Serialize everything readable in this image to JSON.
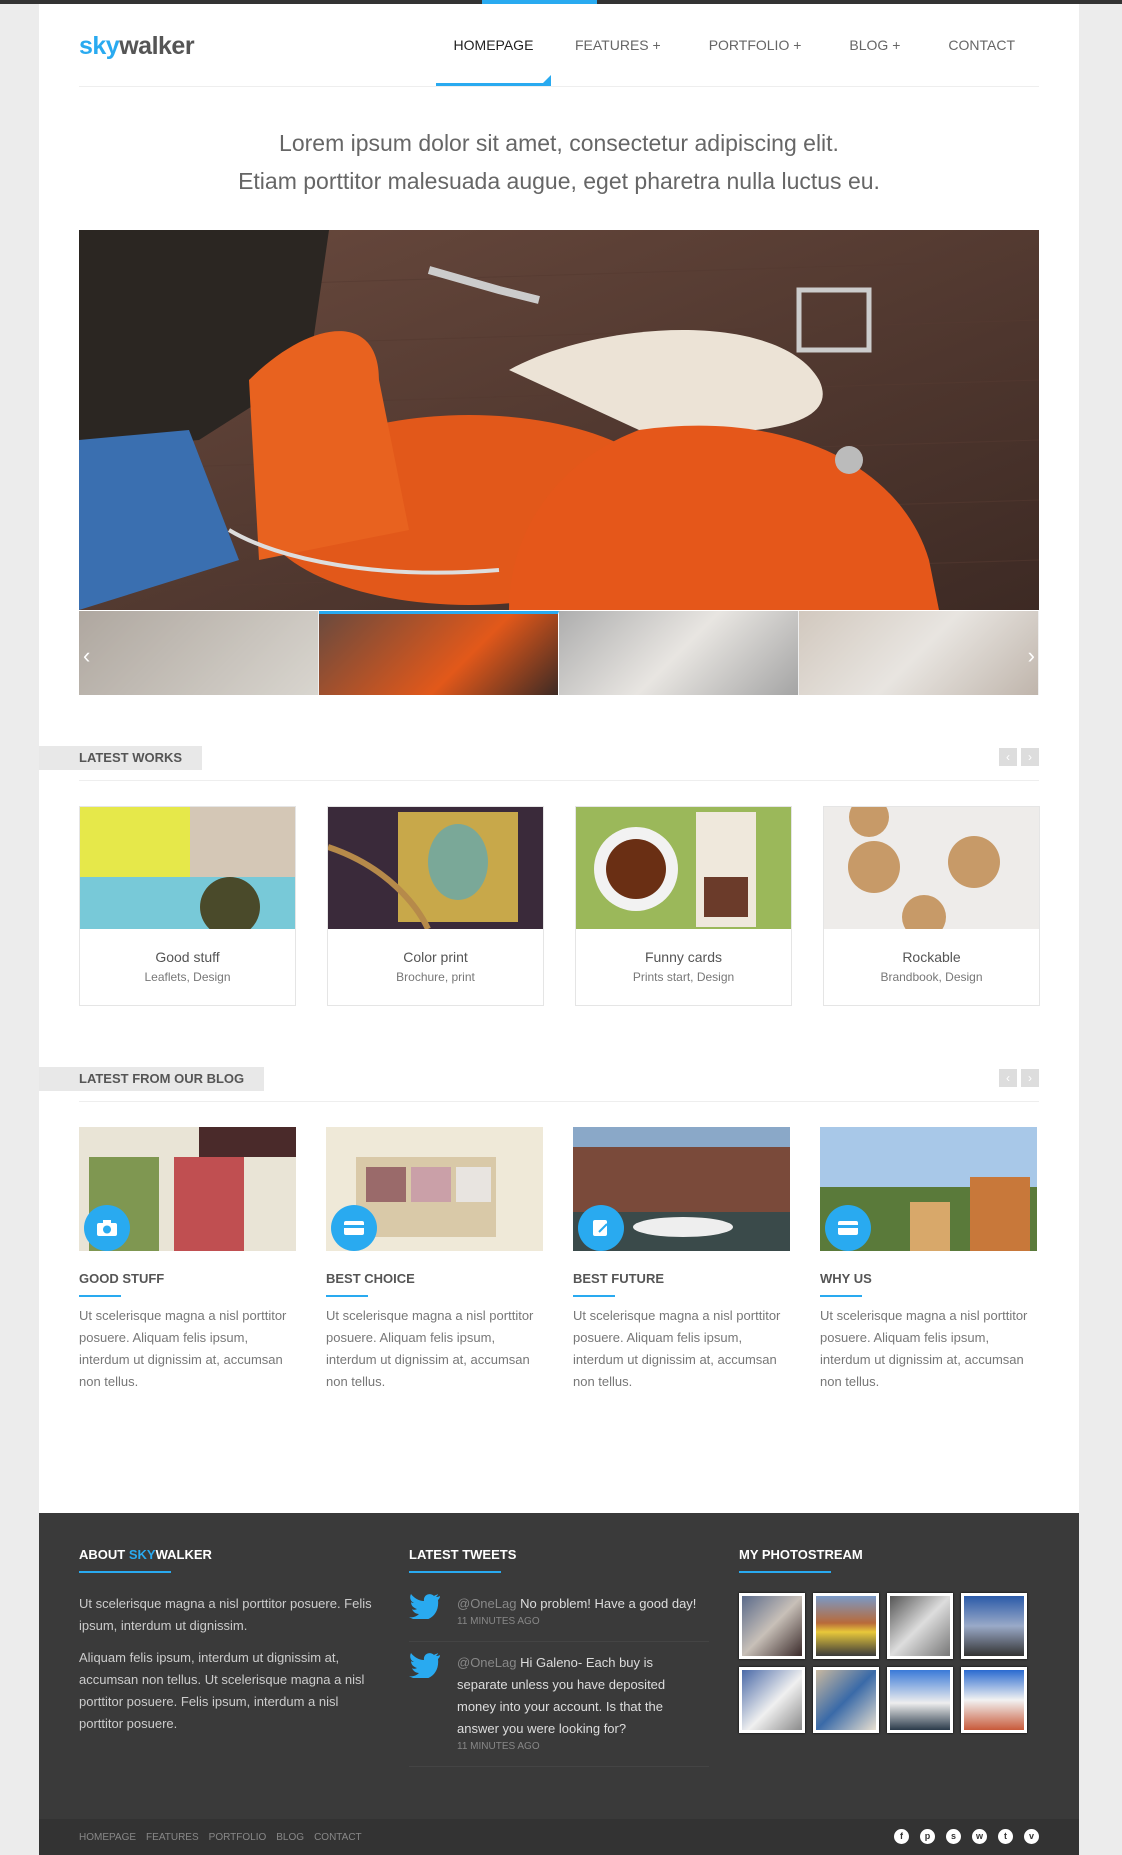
{
  "colors": {
    "accent": "#29aaf0",
    "footer_bg": "#3a3a3a",
    "bottom_bar": "#333333"
  },
  "logo": {
    "sky": "sky",
    "walker": "walker"
  },
  "nav": [
    {
      "label": "HOMEPAGE",
      "active": true
    },
    {
      "label": "FEATURES +"
    },
    {
      "label": "PORTFOLIO +"
    },
    {
      "label": "BLOG +"
    },
    {
      "label": "CONTACT"
    }
  ],
  "intro": {
    "line1": "Lorem ipsum dolor sit amet, consectetur adipiscing elit.",
    "line2": "Etiam porttitor malesuada augue, eget pharetra nulla luctus eu."
  },
  "latest_works": {
    "title": "LATEST WORKS",
    "items": [
      {
        "name": "Good stuff",
        "cats": "Leaflets, Design"
      },
      {
        "name": "Color print",
        "cats": "Brochure, print"
      },
      {
        "name": "Funny cards",
        "cats": "Prints start, Design"
      },
      {
        "name": "Rockable",
        "cats": "Brandbook, Design"
      }
    ]
  },
  "latest_blog": {
    "title": "LATEST FROM OUR BLOG",
    "items": [
      {
        "title": "GOOD STUFF",
        "text": "Ut scelerisque magna a nisl porttitor posuere. Aliquam felis ipsum, interdum ut dignissim at, accumsan non tellus.",
        "icon": "camera-icon"
      },
      {
        "title": "BEST CHOICE",
        "text": "Ut scelerisque magna a nisl porttitor posuere. Aliquam felis ipsum, interdum ut dignissim at, accumsan non tellus.",
        "icon": "card-icon"
      },
      {
        "title": "BEST FUTURE",
        "text": "Ut scelerisque magna a nisl porttitor posuere. Aliquam felis ipsum, interdum ut dignissim at, accumsan non tellus.",
        "icon": "edit-icon"
      },
      {
        "title": "WHY US",
        "text": "Ut scelerisque magna a nisl porttitor posuere. Aliquam felis ipsum, interdum ut dignissim at, accumsan non tellus.",
        "icon": "card-icon"
      }
    ]
  },
  "footer": {
    "about_title_pre": "ABOUT ",
    "about_title_sky": "SKY",
    "about_title_post": "WALKER",
    "about_p1": "Ut scelerisque magna a nisl porttitor posuere. Felis ipsum, interdum ut dignissim.",
    "about_p2": "Aliquam felis ipsum, interdum ut dignissim at, accumsan non tellus. Ut scelerisque magna a nisl porttitor posuere. Felis ipsum, interdum a nisl porttitor posuere.",
    "tweets_title": "LATEST TWEETS",
    "tweets": [
      {
        "handle": "@OneLag",
        "text": " No problem! Have a good day!",
        "time": "11 MINUTES AGO"
      },
      {
        "handle": "@OneLag",
        "text": " Hi Galeno- Each buy is separate unless you have deposited money into your account. Is that the answer you were looking for?",
        "time": "11 MINUTES AGO"
      }
    ],
    "photos_title": "MY PHOTOSTREAM",
    "links": [
      "HOMEPAGE",
      "FEATURES",
      "PORTFOLIO",
      "BLOG",
      "CONTACT"
    ],
    "socials": [
      "f",
      "p",
      "s",
      "w",
      "t",
      "v"
    ]
  }
}
